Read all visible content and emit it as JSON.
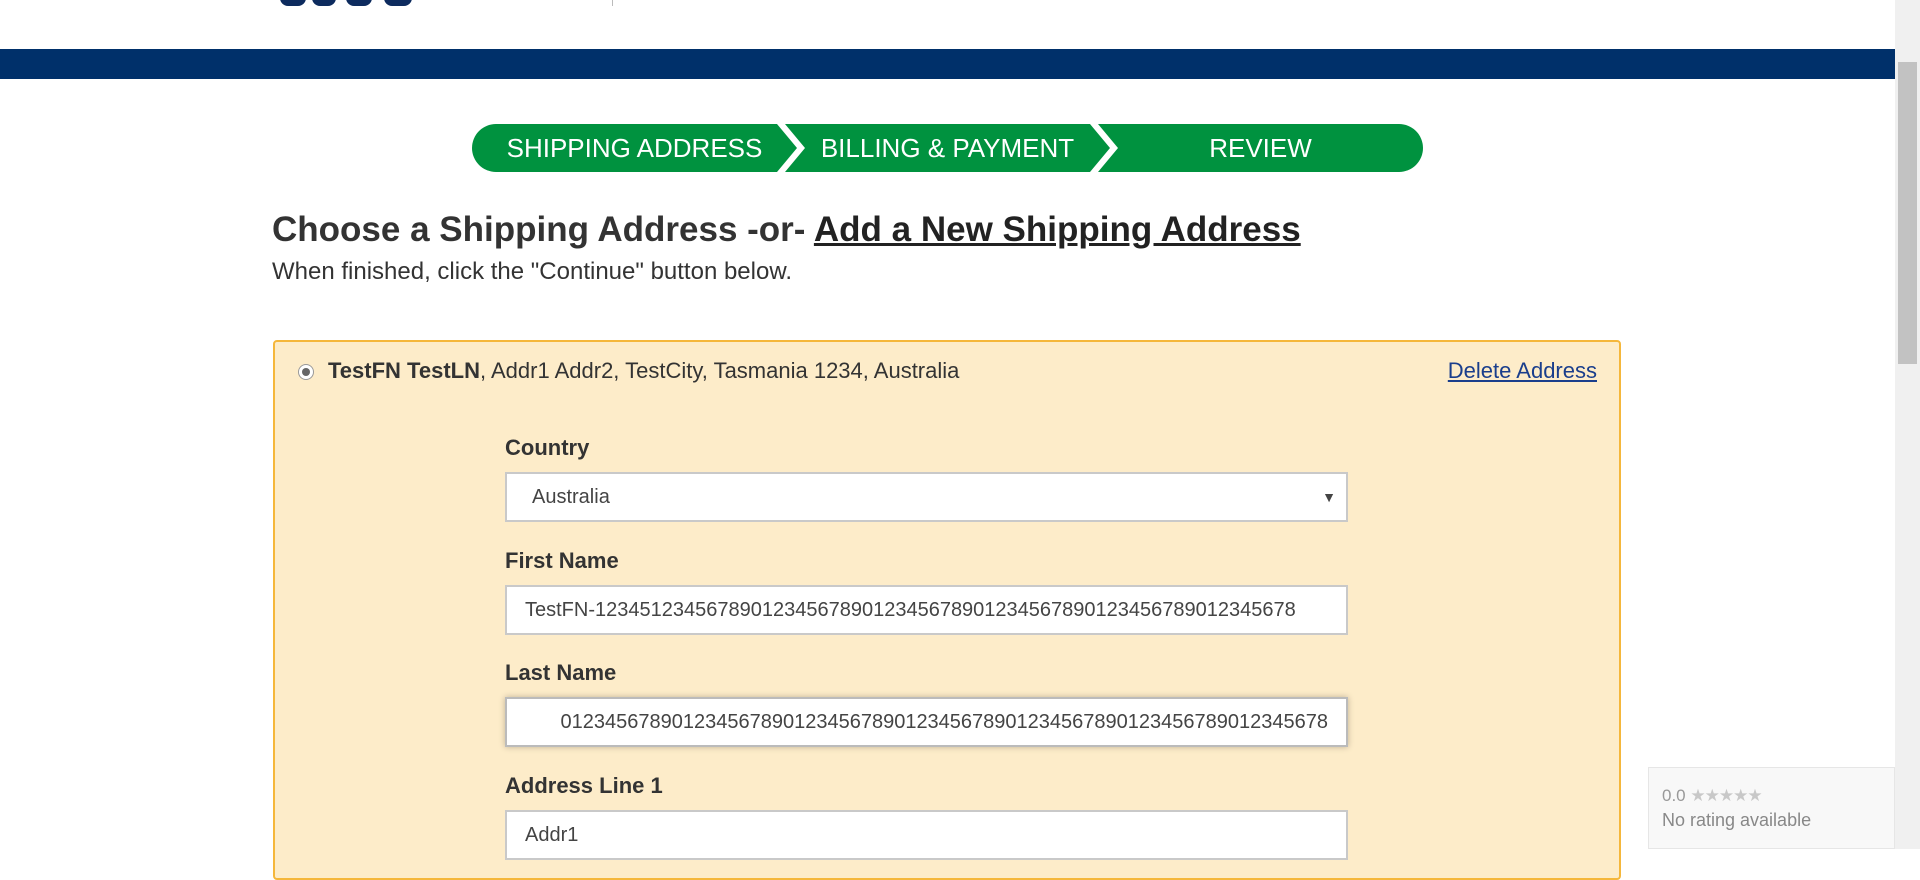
{
  "checkout_steps": [
    {
      "label": "SHIPPING ADDRESS"
    },
    {
      "label": "BILLING & PAYMENT"
    },
    {
      "label": "REVIEW"
    }
  ],
  "heading": {
    "text": "Choose a Shipping Address -or- ",
    "link": "Add a New Shipping Address"
  },
  "subheading": "When finished, click the \"Continue\" button below.",
  "address_card": {
    "name": "TestFN TestLN",
    "details": ", Addr1 Addr2, TestCity, Tasmania 1234, Australia",
    "delete_label": "Delete Address",
    "fields": {
      "country": {
        "label": "Country",
        "value": "Australia"
      },
      "first_name": {
        "label": "First Name",
        "value": "TestFN-123451234567890123456789012345678901234567890123456789012345678"
      },
      "last_name": {
        "label": "Last Name",
        "value": "012345678901234567890123456789012345678901234567890123456789012345678"
      },
      "address_line_1": {
        "label": "Address Line 1",
        "value": "Addr1"
      }
    }
  },
  "rating_widget": {
    "score": "0.0",
    "stars": "★★★★★",
    "text": "No rating available"
  },
  "colors": {
    "navy": "#00306a",
    "step_green": "#00923f",
    "panel_bg": "#fdecc9",
    "panel_border": "#f5b73b",
    "link": "#1a3e8c"
  }
}
